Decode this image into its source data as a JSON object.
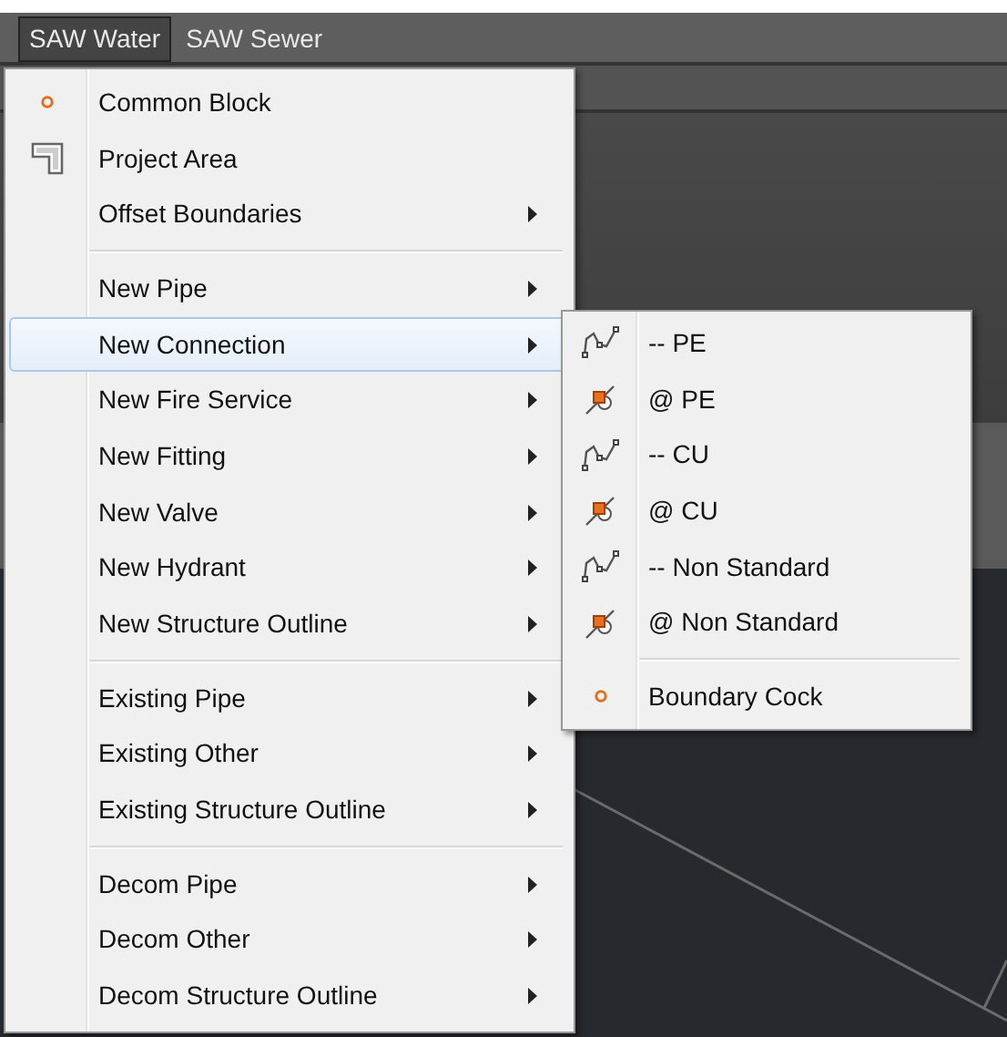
{
  "menubar": [
    {
      "label": "SAW Water",
      "selected": true
    },
    {
      "label": "SAW Sewer",
      "selected": false
    }
  ],
  "menu": {
    "groups": [
      [
        {
          "label": "Common Block",
          "kind": "dot",
          "submenu": false,
          "selected": false
        },
        {
          "label": "Project Area",
          "kind": "area",
          "submenu": false,
          "selected": false
        },
        {
          "label": "Offset Boundaries",
          "submenu": true,
          "selected": false
        }
      ],
      [
        {
          "label": "New Pipe",
          "submenu": true,
          "selected": false
        },
        {
          "label": "New Connection",
          "submenu": true,
          "selected": true
        },
        {
          "label": "New Fire Service",
          "submenu": true,
          "selected": false
        },
        {
          "label": "New Fitting",
          "submenu": true,
          "selected": false
        },
        {
          "label": "New Valve",
          "submenu": true,
          "selected": false
        },
        {
          "label": "New Hydrant",
          "submenu": true,
          "selected": false
        },
        {
          "label": "New Structure Outline",
          "submenu": true,
          "selected": false
        }
      ],
      [
        {
          "label": "Existing Pipe",
          "submenu": true,
          "selected": false
        },
        {
          "label": "Existing Other",
          "submenu": true,
          "selected": false
        },
        {
          "label": "Existing Structure Outline",
          "submenu": true,
          "selected": false
        }
      ],
      [
        {
          "label": "Decom Pipe",
          "submenu": true,
          "selected": false
        },
        {
          "label": "Decom Other",
          "submenu": true,
          "selected": false
        },
        {
          "label": "Decom Structure Outline",
          "submenu": true,
          "selected": false
        }
      ]
    ]
  },
  "submenu": {
    "groups": [
      [
        {
          "label": "-- PE",
          "kind": "polyline"
        },
        {
          "label": "@ PE",
          "kind": "point"
        },
        {
          "label": "-- CU",
          "kind": "polyline"
        },
        {
          "label": "@ CU",
          "kind": "point"
        },
        {
          "label": "-- Non Standard",
          "kind": "polyline"
        },
        {
          "label": "@ Non Standard",
          "kind": "point"
        }
      ],
      [
        {
          "label": "Boundary Cock",
          "kind": "dot"
        }
      ]
    ]
  }
}
